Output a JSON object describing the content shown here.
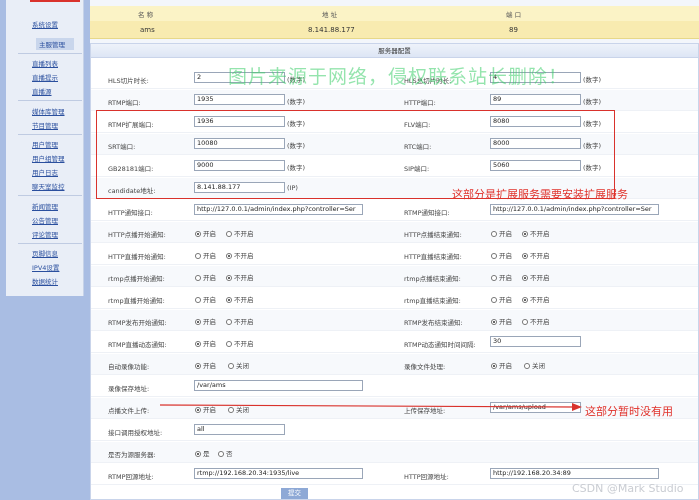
{
  "sidebar": {
    "top_link": "系统设置",
    "active": "主服管理",
    "groups": [
      [
        "直播列表",
        "直播提示",
        "直播源"
      ],
      [
        "媒体库管理",
        "节目管理"
      ],
      [
        "用户管理",
        "用户组管理",
        "用户日志",
        "聊天室监控"
      ],
      [
        "新闻管理",
        "公告管理",
        "评论管理"
      ],
      [
        "页脚信息",
        "IPV4设置",
        "数据统计"
      ]
    ]
  },
  "server_list": {
    "headers": [
      "名 称",
      "地 址",
      "端 口"
    ],
    "row": [
      "ams",
      "8.141.88.177",
      "89"
    ]
  },
  "form": {
    "title": "服务器配置",
    "hls_seg": {
      "label": "HLS切片时长:",
      "value": "2",
      "unit": "(数字)"
    },
    "hls_win": {
      "label": "HLS总切片时长:",
      "value": "4",
      "unit": "(数字)"
    },
    "rtmp_port": {
      "label": "RTMP端口:",
      "value": "1935",
      "unit": "(数字)"
    },
    "http_port": {
      "label": "HTTP端口:",
      "value": "89",
      "unit": "(数字)"
    },
    "rtmp_ext_port": {
      "label": "RTMP扩展端口:",
      "value": "1936",
      "unit": "(数字)"
    },
    "flv_port": {
      "label": "FLV端口:",
      "value": "8080",
      "unit": "(数字)"
    },
    "srt_port": {
      "label": "SRT端口:",
      "value": "10080",
      "unit": "(数字)"
    },
    "rtc_port": {
      "label": "RTC端口:",
      "value": "8000",
      "unit": "(数字)"
    },
    "gb_port": {
      "label": "GB28181端口:",
      "value": "9000",
      "unit": "(数字)"
    },
    "sip_port": {
      "label": "SIP端口:",
      "value": "5060",
      "unit": "(数字)"
    },
    "candidate": {
      "label": "candidate地址:",
      "value": "8.141.88.177",
      "unit": "(IP)"
    },
    "http_notify": {
      "label": "HTTP通知接口:",
      "value": "http://127.0.0.1/admin/index.php?controller=Ser"
    },
    "rtmp_notify": {
      "label": "RTMP通知接口:",
      "value": "http://127.0.0.1/admin/index.php?controller=Ser"
    },
    "radio_on": "开启",
    "radio_off": "不开启",
    "radio_close": "关闭",
    "radio_yes": "是",
    "radio_no": "否",
    "r_http_vod_start": "HTTP点播开始通知:",
    "r_http_vod_end": "HTTP点播结束通知:",
    "r_http_live_start": "HTTP直播开始通知:",
    "r_http_live_end": "HTTP直播结束通知:",
    "r_rtmp_vod_start": "rtmp点播开始通知:",
    "r_rtmp_vod_end": "rtmp点播结束通知:",
    "r_rtmp_live_start": "rtmp直播开始通知:",
    "r_rtmp_live_end": "rtmp直播结束通知:",
    "r_rtmp_pub_start": "RTMP发布开始通知:",
    "r_rtmp_pub_end": "RTMP发布结束通知:",
    "r_rtmp_dyn": "RTMP直播动态通知:",
    "rtmp_dyn_interval": {
      "label": "RTMP动态通知时间间隔:",
      "value": "30"
    },
    "r_auto_record": "自动录像功能:",
    "r_record_proc": "录像文件处理:",
    "record_path": {
      "label": "录像保存地址:",
      "value": "/var/ams"
    },
    "r_vod_upload": "点播文件上传:",
    "upload_path": {
      "label": "上传保存地址:",
      "value": "/var/ams/upload"
    },
    "api_auth": {
      "label": "接口调用授权地址:",
      "value": "all"
    },
    "r_origin": "是否为源服务器:",
    "rtmp_origin": {
      "label": "RTMP回源地址:",
      "value": "rtmp://192.168.20.34:1935/live"
    },
    "http_origin": {
      "label": "HTTP回源地址:",
      "value": "http://192.168.20.34:89"
    },
    "submit": "提交"
  },
  "annotations": {
    "note1": "这部分是扩展服务需要安装扩展服务",
    "note2": "这部分暂时没有用",
    "watermark": "图片来源于网络，侵权联系站长删除！",
    "credit": "CSDN @Mark Studio",
    "accent": "#e0312a"
  }
}
